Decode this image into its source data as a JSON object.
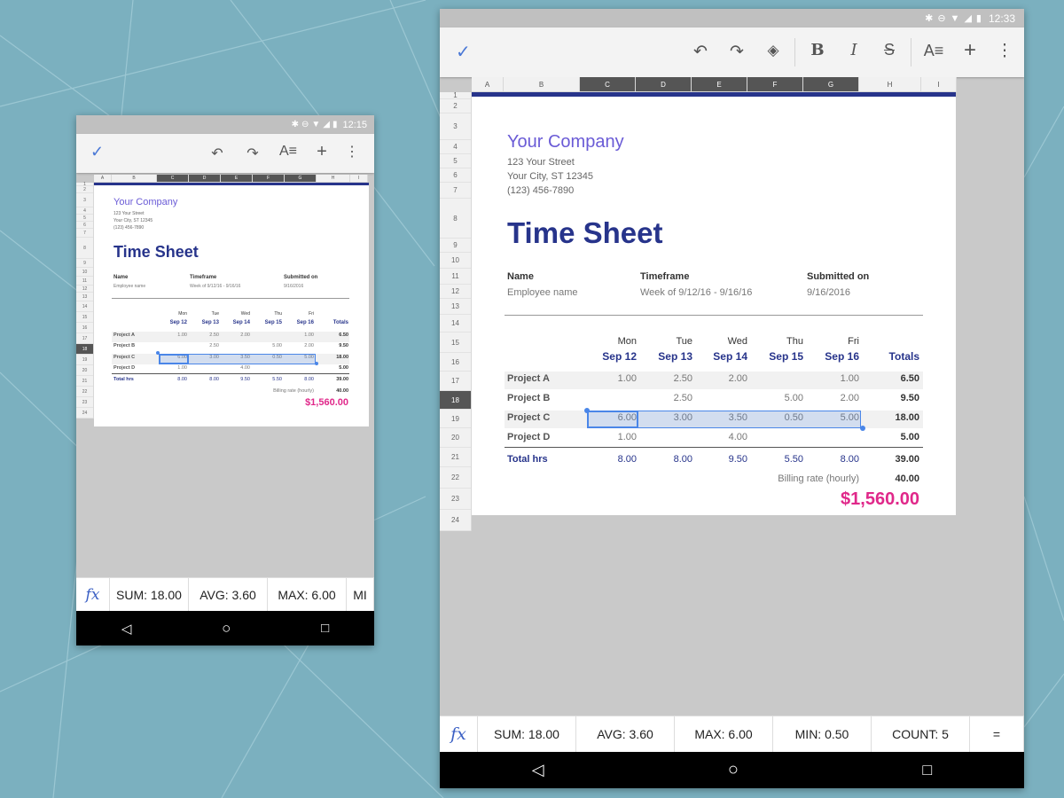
{
  "phone": {
    "status": {
      "time": "12:15",
      "icons": [
        "bluetooth-icon",
        "do-not-disturb-icon",
        "wifi-icon",
        "signal-icon",
        "battery-icon"
      ]
    },
    "stats": [
      "SUM: 18.00",
      "AVG: 3.60",
      "MAX: 6.00",
      "MI"
    ]
  },
  "tablet": {
    "status": {
      "time": "12:33",
      "icons": [
        "bluetooth-icon",
        "do-not-disturb-icon",
        "wifi-icon",
        "signal-icon",
        "battery-icon"
      ]
    },
    "stats": [
      "SUM: 18.00",
      "AVG: 3.60",
      "MAX: 6.00",
      "MIN: 0.50",
      "COUNT: 5",
      "="
    ]
  },
  "toolbar_icons": {
    "done": "check-icon",
    "undo": "undo-icon",
    "redo": "redo-icon",
    "fill": "fill-color-icon",
    "bold": "bold-icon",
    "italic": "italic-icon",
    "strike": "strikethrough-icon",
    "format": "text-format-icon",
    "insert": "add-icon",
    "more": "more-vert-icon"
  },
  "fx": "fx",
  "columns": [
    "A",
    "B",
    "C",
    "D",
    "E",
    "F",
    "G",
    "H",
    "I"
  ],
  "rows": [
    "1",
    "2",
    "3",
    "4",
    "5",
    "6",
    "7",
    "8",
    "9",
    "10",
    "11",
    "12",
    "13",
    "14",
    "15",
    "16",
    "17",
    "18",
    "19",
    "20",
    "21",
    "22",
    "23",
    "24"
  ],
  "sheet": {
    "company": "Your Company",
    "street": "123 Your Street",
    "city": "Your City, ST 12345",
    "phone": "(123) 456-7890",
    "title": "Time Sheet",
    "name_label": "Name",
    "name_value": "Employee name",
    "timeframe_label": "Timeframe",
    "timeframe_value": "Week of 9/12/16 - 9/16/16",
    "submitted_label": "Submitted on",
    "submitted_value": "9/16/2016",
    "days": [
      {
        "name": "Mon",
        "date": "Sep 12"
      },
      {
        "name": "Tue",
        "date": "Sep 13"
      },
      {
        "name": "Wed",
        "date": "Sep 14"
      },
      {
        "name": "Thu",
        "date": "Sep 15"
      },
      {
        "name": "Fri",
        "date": "Sep 16"
      }
    ],
    "totals_label": "Totals",
    "projects": [
      {
        "name": "Project A",
        "hours": [
          "1.00",
          "2.50",
          "2.00",
          "",
          "1.00"
        ],
        "total": "6.50"
      },
      {
        "name": "Project B",
        "hours": [
          "",
          "2.50",
          "",
          "5.00",
          "2.00"
        ],
        "total": "9.50"
      },
      {
        "name": "Project C",
        "hours": [
          "6.00",
          "3.00",
          "3.50",
          "0.50",
          "5.00"
        ],
        "total": "18.00"
      },
      {
        "name": "Project D",
        "hours": [
          "1.00",
          "",
          "4.00",
          "",
          ""
        ],
        "total": "5.00"
      }
    ],
    "total_hrs_label": "Total hrs",
    "total_hrs": [
      "8.00",
      "8.00",
      "9.50",
      "5.50",
      "8.00"
    ],
    "total_hrs_sum": "39.00",
    "billing_label": "Billing rate (hourly)",
    "billing_value": "40.00",
    "grand_total": "$1,560.00"
  }
}
